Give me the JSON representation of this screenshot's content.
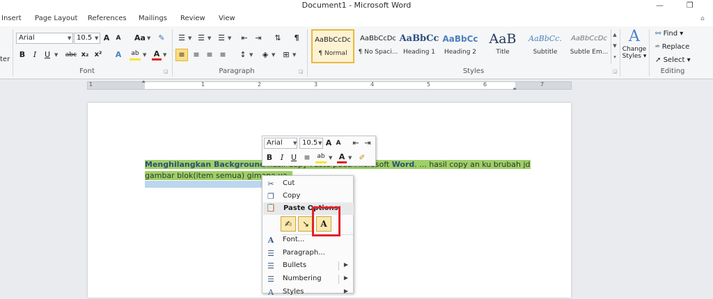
{
  "window": {
    "title": "Document1  -  Microsoft Word",
    "minimize_glyph": "—",
    "restore_glyph": "❐"
  },
  "tabs": [
    "Insert",
    "Page Layout",
    "References",
    "Mailings",
    "Review",
    "View"
  ],
  "ribbon": {
    "cut_partial_label": "ter",
    "font": {
      "group_label": "Font",
      "font_name": "Arial",
      "font_size": "10.5",
      "grow_label": "A",
      "shrink_label": "A",
      "change_case_label": "Aa",
      "bold": "B",
      "italic": "I",
      "underline": "U",
      "strike": "abc",
      "subscript": "x₂",
      "superscript": "x²",
      "font_color": "A",
      "highlight": "ab"
    },
    "paragraph": {
      "group_label": "Paragraph",
      "show_marks": "¶"
    },
    "styles": {
      "group_label": "Styles",
      "items": [
        {
          "preview": "AaBbCcDc",
          "name": "¶ Normal"
        },
        {
          "preview": "AaBbCcDc",
          "name": "¶ No Spaci..."
        },
        {
          "preview": "AaBbCc",
          "name": "Heading 1"
        },
        {
          "preview": "AaBbCc",
          "name": "Heading 2"
        },
        {
          "preview": "AaB",
          "name": "Title"
        },
        {
          "preview": "AaBbCc.",
          "name": "Subtitle"
        },
        {
          "preview": "AaBbCcDc",
          "name": "Subtle Em..."
        }
      ],
      "change_styles_line1": "Change",
      "change_styles_line2": "Styles"
    },
    "editing": {
      "group_label": "Editing",
      "find": "Find",
      "replace": "Replace",
      "select": "Select"
    }
  },
  "ruler": {
    "numbers": [
      "1",
      "1",
      "2",
      "3",
      "4",
      "5",
      "6",
      "7"
    ]
  },
  "document": {
    "bold_part": "Menghilangkan Background",
    "mid_part": " hasil Copy Paste pada Microsoft ",
    "bold_word": "Word",
    "rest_line1": ". ... hasil copy an ku brubah jd",
    "line2": "gambar blok(item semua) gimana ya.."
  },
  "mini_toolbar": {
    "font_name": "Arial",
    "font_size": "10.5",
    "bold": "B",
    "italic": "I",
    "underline": "U"
  },
  "context_menu": {
    "cut": "Cut",
    "copy": "Copy",
    "paste_options": "Paste Options:",
    "font": "Font...",
    "paragraph": "Paragraph...",
    "bullets": "Bullets",
    "numbering": "Numbering",
    "styles_partial": "Styles"
  }
}
